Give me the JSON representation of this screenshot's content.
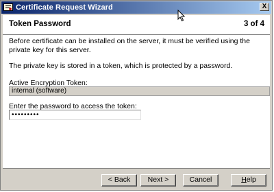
{
  "window": {
    "title": "Certificate Request Wizard",
    "close_label": "X"
  },
  "header": {
    "page_title": "Token Password",
    "step": "3 of 4"
  },
  "content": {
    "paragraph1": "Before certificate can be installed on the server, it must be verified using the private key for this server.",
    "paragraph2": "The private key is stored in a token, which is protected by a password.",
    "token_label": "Active Encryption Token:",
    "token_value": "internal (software)",
    "password_label": "Enter the password to access the token:",
    "password_value": "•••••••••"
  },
  "buttons": {
    "back": "< Back",
    "next": "Next >",
    "cancel": "Cancel",
    "help_mnemonic": "H",
    "help_rest": "elp"
  },
  "colors": {
    "titlebar_start": "#0a246a",
    "titlebar_end": "#a6caf0",
    "face": "#d4d0c8"
  },
  "icons": {
    "app": "certificate-icon",
    "close": "close-icon",
    "cursor": "mouse-cursor-icon"
  }
}
